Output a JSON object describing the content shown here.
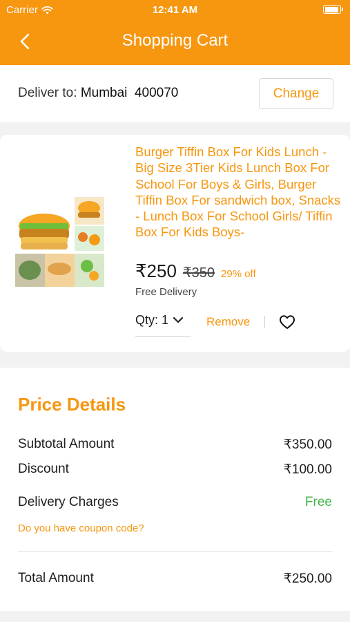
{
  "status_bar": {
    "carrier": "Carrier",
    "time": "12:41 AM"
  },
  "header": {
    "title": "Shopping Cart"
  },
  "delivery": {
    "label": "Deliver to:",
    "location": "Mumbai  400070",
    "change_label": "Change"
  },
  "product": {
    "title": "Burger Tiffin Box For Kids Lunch -Big Size 3Tier Kids Lunch Box For School For Boys & Girls, Burger Tiffin Box For sandwich box, Snacks - Lunch Box For School Girls/ Tiffin Box For Kids Boys-",
    "price": "₹250",
    "mrp": "₹350",
    "discount": "29% off",
    "delivery_note": "Free Delivery",
    "qty_label": "Qty: 1",
    "remove_label": "Remove"
  },
  "price_details": {
    "heading": "Price Details",
    "subtotal_label": "Subtotal Amount",
    "subtotal_value": "₹350.00",
    "discount_label": "Discount",
    "discount_value": "₹100.00",
    "delivery_label": "Delivery Charges",
    "delivery_value": "Free",
    "coupon_prompt": "Do you have coupon code?",
    "total_label": "Total Amount",
    "total_value": "₹250.00"
  },
  "colors": {
    "accent": "#f7960f",
    "free": "#43b548",
    "background": "#f2f2f2"
  },
  "icons": [
    "wifi-icon",
    "battery-icon",
    "back-arrow-icon",
    "chevron-down-icon",
    "heart-icon"
  ]
}
